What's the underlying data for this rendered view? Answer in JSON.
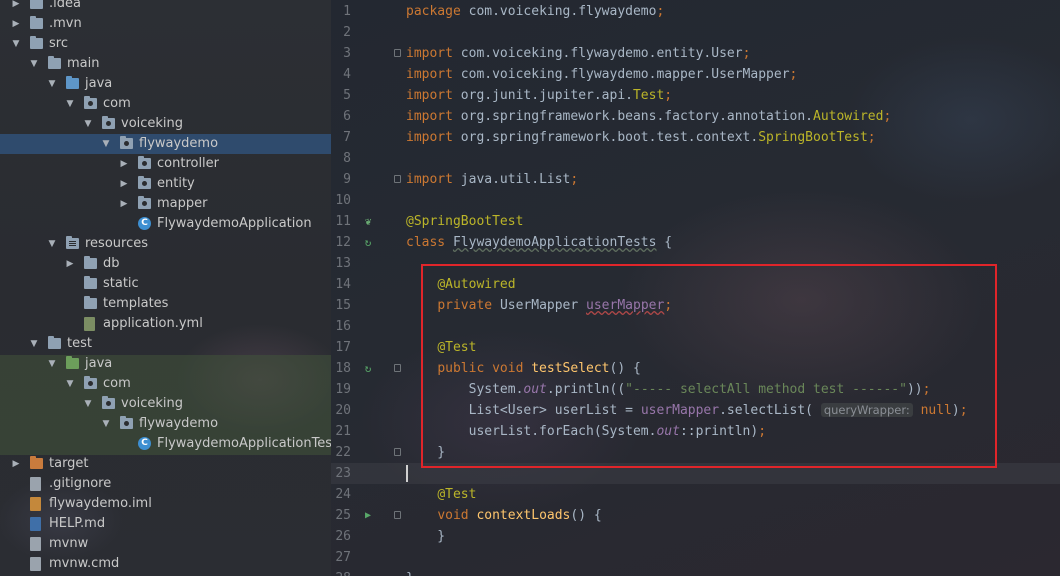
{
  "project_tree": [
    {
      "depth": 0,
      "arrow": "right",
      "icon": "folder",
      "label": ".idea",
      "name": "idea-folder"
    },
    {
      "depth": 0,
      "arrow": "right",
      "icon": "folder",
      "label": ".mvn",
      "name": "mvn-folder"
    },
    {
      "depth": 0,
      "arrow": "down",
      "icon": "folder",
      "label": "src",
      "name": "src-folder"
    },
    {
      "depth": 1,
      "arrow": "down",
      "icon": "folder",
      "label": "main",
      "name": "main-folder"
    },
    {
      "depth": 2,
      "arrow": "down",
      "icon": "folder-blue",
      "label": "java",
      "name": "main-java-folder"
    },
    {
      "depth": 3,
      "arrow": "down",
      "icon": "package",
      "label": "com",
      "name": "main-com-package"
    },
    {
      "depth": 4,
      "arrow": "down",
      "icon": "package",
      "label": "voiceking",
      "name": "main-voiceking-package"
    },
    {
      "depth": 5,
      "arrow": "down",
      "icon": "package",
      "label": "flywaydemo",
      "name": "main-flywaydemo-package",
      "selected": true
    },
    {
      "depth": 6,
      "arrow": "right",
      "icon": "package",
      "label": "controller",
      "name": "controller-package"
    },
    {
      "depth": 6,
      "arrow": "right",
      "icon": "package",
      "label": "entity",
      "name": "entity-package"
    },
    {
      "depth": 6,
      "arrow": "right",
      "icon": "package",
      "label": "mapper",
      "name": "mapper-package"
    },
    {
      "depth": 6,
      "arrow": "",
      "icon": "class",
      "label": "FlywaydemoApplication",
      "name": "flywaydemo-application-class"
    },
    {
      "depth": 2,
      "arrow": "down",
      "icon": "resources",
      "label": "resources",
      "name": "resources-folder"
    },
    {
      "depth": 3,
      "arrow": "right",
      "icon": "folder",
      "label": "db",
      "name": "db-folder"
    },
    {
      "depth": 3,
      "arrow": "",
      "icon": "folder",
      "label": "static",
      "name": "static-folder"
    },
    {
      "depth": 3,
      "arrow": "",
      "icon": "folder",
      "label": "templates",
      "name": "templates-folder"
    },
    {
      "depth": 3,
      "arrow": "",
      "icon": "yml",
      "label": "application.yml",
      "name": "application-yml-file"
    },
    {
      "depth": 1,
      "arrow": "down",
      "icon": "folder",
      "label": "test",
      "name": "test-folder"
    },
    {
      "depth": 2,
      "arrow": "down",
      "icon": "folder-green",
      "label": "java",
      "name": "test-java-folder"
    },
    {
      "depth": 3,
      "arrow": "down",
      "icon": "package",
      "label": "com",
      "name": "test-com-package"
    },
    {
      "depth": 4,
      "arrow": "down",
      "icon": "package",
      "label": "voiceking",
      "name": "test-voiceking-package"
    },
    {
      "depth": 5,
      "arrow": "down",
      "icon": "package",
      "label": "flywaydemo",
      "name": "test-flywaydemo-package"
    },
    {
      "depth": 6,
      "arrow": "",
      "icon": "class-test",
      "label": "FlywaydemoApplicationTests",
      "name": "flywaydemo-application-tests-class"
    },
    {
      "depth": 0,
      "arrow": "right",
      "icon": "folder-orange",
      "label": "target",
      "name": "target-folder"
    },
    {
      "depth": 0,
      "arrow": "",
      "icon": "file",
      "label": ".gitignore",
      "name": "gitignore-file"
    },
    {
      "depth": 0,
      "arrow": "",
      "icon": "xml",
      "label": "flywaydemo.iml",
      "name": "iml-file"
    },
    {
      "depth": 0,
      "arrow": "",
      "icon": "md",
      "label": "HELP.md",
      "name": "help-md-file"
    },
    {
      "depth": 0,
      "arrow": "",
      "icon": "file",
      "label": "mvnw",
      "name": "mvnw-file"
    },
    {
      "depth": 0,
      "arrow": "",
      "icon": "file",
      "label": "mvnw.cmd",
      "name": "mvnw-cmd-file"
    }
  ],
  "editor": {
    "lines": [
      {
        "n": "1",
        "tokens": [
          {
            "t": "package ",
            "c": "kw"
          },
          {
            "t": "com.voiceking.flywaydemo",
            "c": ""
          },
          {
            "t": ";",
            "c": "kw"
          }
        ]
      },
      {
        "n": "2",
        "tokens": []
      },
      {
        "n": "3",
        "fold": true,
        "tokens": [
          {
            "t": "import ",
            "c": "kw"
          },
          {
            "t": "com.voiceking.flywaydemo.entity.User",
            "c": ""
          },
          {
            "t": ";",
            "c": "kw"
          }
        ]
      },
      {
        "n": "4",
        "tokens": [
          {
            "t": "import ",
            "c": "kw"
          },
          {
            "t": "com.voiceking.flywaydemo.mapper.UserMapper",
            "c": ""
          },
          {
            "t": ";",
            "c": "kw"
          }
        ]
      },
      {
        "n": "5",
        "tokens": [
          {
            "t": "import ",
            "c": "kw"
          },
          {
            "t": "org.junit.jupiter.api.",
            "c": ""
          },
          {
            "t": "Test",
            "c": "ann"
          },
          {
            "t": ";",
            "c": "kw"
          }
        ]
      },
      {
        "n": "6",
        "tokens": [
          {
            "t": "import ",
            "c": "kw"
          },
          {
            "t": "org.springframework.beans.factory.annotation.",
            "c": ""
          },
          {
            "t": "Autowired",
            "c": "ann"
          },
          {
            "t": ";",
            "c": "kw"
          }
        ]
      },
      {
        "n": "7",
        "tokens": [
          {
            "t": "import ",
            "c": "kw"
          },
          {
            "t": "org.springframework.boot.test.context.",
            "c": ""
          },
          {
            "t": "SpringBootTest",
            "c": "ann"
          },
          {
            "t": ";",
            "c": "kw"
          }
        ]
      },
      {
        "n": "8",
        "tokens": []
      },
      {
        "n": "9",
        "fold": true,
        "tokens": [
          {
            "t": "import ",
            "c": "kw"
          },
          {
            "t": "java.util.List",
            "c": ""
          },
          {
            "t": ";",
            "c": "kw"
          }
        ]
      },
      {
        "n": "10",
        "tokens": []
      },
      {
        "n": "11",
        "gicon": "spring",
        "tokens": [
          {
            "t": "@SpringBootTest",
            "c": "ann"
          }
        ]
      },
      {
        "n": "12",
        "gicon": "run-spring",
        "tokens": [
          {
            "t": "class ",
            "c": "kw"
          },
          {
            "t": "FlywaydemoApplicationTests",
            "c": "wave"
          },
          {
            "t": " {",
            "c": ""
          }
        ]
      },
      {
        "n": "13",
        "tokens": []
      },
      {
        "n": "14",
        "tokens": [
          {
            "t": "    ",
            "c": ""
          },
          {
            "t": "@Autowired",
            "c": "ann"
          }
        ]
      },
      {
        "n": "15",
        "tokens": [
          {
            "t": "    ",
            "c": ""
          },
          {
            "t": "private ",
            "c": "kw"
          },
          {
            "t": "UserMapper ",
            "c": ""
          },
          {
            "t": "userMapper",
            "c": "fld wave-red"
          },
          {
            "t": ";",
            "c": "kw"
          }
        ]
      },
      {
        "n": "16",
        "tokens": []
      },
      {
        "n": "17",
        "tokens": [
          {
            "t": "    ",
            "c": ""
          },
          {
            "t": "@Test",
            "c": "ann"
          }
        ]
      },
      {
        "n": "18",
        "gicon": "run-spring",
        "fold": true,
        "tokens": [
          {
            "t": "    ",
            "c": ""
          },
          {
            "t": "public void ",
            "c": "kw"
          },
          {
            "t": "testSelect",
            "c": "fn"
          },
          {
            "t": "() {",
            "c": ""
          }
        ]
      },
      {
        "n": "19",
        "tokens": [
          {
            "t": "        System.",
            "c": ""
          },
          {
            "t": "out",
            "c": "fld it"
          },
          {
            "t": ".println((",
            "c": ""
          },
          {
            "t": "\"----- selectAll method test ------\"",
            "c": "str"
          },
          {
            "t": "))",
            "c": ""
          },
          {
            "t": ";",
            "c": "kw"
          }
        ]
      },
      {
        "n": "20",
        "tokens": [
          {
            "t": "        List<User> userList = ",
            "c": ""
          },
          {
            "t": "userMapper",
            "c": "fld"
          },
          {
            "t": ".selectList( ",
            "c": ""
          },
          {
            "t": "queryWrapper:",
            "c": "hint"
          },
          {
            "t": " ",
            "c": ""
          },
          {
            "t": "null",
            "c": "kw"
          },
          {
            "t": ")",
            "c": ""
          },
          {
            "t": ";",
            "c": "kw"
          }
        ]
      },
      {
        "n": "21",
        "tokens": [
          {
            "t": "        userList.forEach(System.",
            "c": ""
          },
          {
            "t": "out",
            "c": "fld it"
          },
          {
            "t": "::println)",
            "c": ""
          },
          {
            "t": ";",
            "c": "kw"
          }
        ]
      },
      {
        "n": "22",
        "fold": true,
        "tokens": [
          {
            "t": "    }",
            "c": ""
          }
        ]
      },
      {
        "n": "23",
        "current": true,
        "caret": true,
        "tokens": []
      },
      {
        "n": "24",
        "tokens": [
          {
            "t": "    ",
            "c": ""
          },
          {
            "t": "@Test",
            "c": "ann"
          }
        ]
      },
      {
        "n": "25",
        "gicon": "run",
        "fold": true,
        "tokens": [
          {
            "t": "    ",
            "c": ""
          },
          {
            "t": "void ",
            "c": "kw"
          },
          {
            "t": "contextLoads",
            "c": "fn"
          },
          {
            "t": "() {",
            "c": ""
          }
        ]
      },
      {
        "n": "26",
        "tokens": [
          {
            "t": "    }",
            "c": ""
          }
        ]
      },
      {
        "n": "27",
        "tokens": []
      },
      {
        "n": "28",
        "tokens": [
          {
            "t": "}",
            "c": ""
          }
        ]
      }
    ]
  },
  "colors": {
    "highlight_box": "#e0252a",
    "keyword": "#cc7832",
    "annotation": "#bbb529",
    "method": "#ffc66d",
    "field": "#9876aa",
    "string": "#6a8759"
  }
}
